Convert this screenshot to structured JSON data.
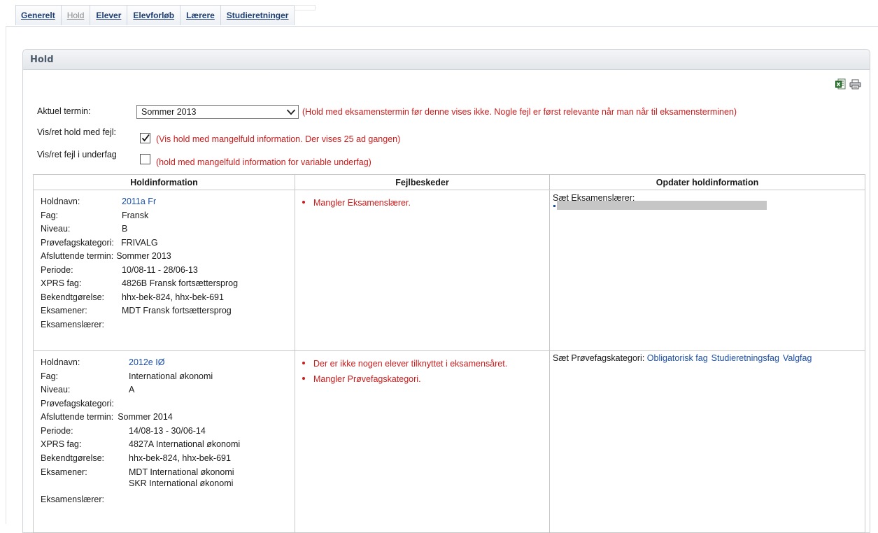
{
  "tabs": [
    {
      "label": "Generelt",
      "disabled": false
    },
    {
      "label": "Hold",
      "disabled": true
    },
    {
      "label": "Elever",
      "disabled": false
    },
    {
      "label": "Elevforløb",
      "disabled": false
    },
    {
      "label": "Lærere",
      "disabled": false
    },
    {
      "label": "Studieretninger",
      "disabled": false
    }
  ],
  "panel": {
    "title": "Hold",
    "icons": [
      "excel-export-icon",
      "print-icon"
    ]
  },
  "filters": {
    "termin_label": "Aktuel termin:",
    "termin_value": "Sommer 2013",
    "termin_hint": "(Hold med eksamenstermin før denne vises ikke. Nogle fejl er først relevante når man når til eksamensterminen)",
    "errors_label": "Vis/ret hold med fejl:",
    "errors_checked": true,
    "errors_hint": "(Vis hold med mangelfuld information. Der vises 25 ad gangen)",
    "sub_label": "Vis/ret fejl i underfag",
    "sub_checked": false,
    "sub_hint": "(hold med mangelfuld information for variable underfag)"
  },
  "table": {
    "headers": [
      "Holdinformation",
      "Fejlbeskeder",
      "Opdater holdinformation"
    ],
    "keys": {
      "holdnavn": "Holdnavn:",
      "fag": "Fag:",
      "niveau": "Niveau:",
      "kategori": "Prøvefagskategori:",
      "termin": "Afsluttende termin:",
      "periode": "Periode:",
      "xprs": "XPRS fag:",
      "bek": "Bekendtgørelse:",
      "eksamener": "Eksamener:",
      "laerer": "Eksamenslærer:"
    },
    "rows": [
      {
        "holdnavn": "2011a Fr",
        "fag": "Fransk",
        "niveau": "B",
        "kategori": "FRIVALG",
        "termin": "Sommer 2013",
        "periode": "10/08-11 - 28/06-13",
        "xprs": "4826B Fransk fortsættersprog",
        "bek": "hhx-bek-824, hhx-bek-691",
        "eksamener": [
          "MDT Fransk fortsættersprog"
        ],
        "laerer": "",
        "errors": [
          "Mangler Eksamenslærer."
        ],
        "update_label": "Sæt Eksamenslærer:",
        "update_links": []
      },
      {
        "holdnavn": "2012e IØ",
        "fag": "International økonomi",
        "niveau": "A",
        "kategori": "",
        "termin": "Sommer 2014",
        "periode": "14/08-13 - 30/06-14",
        "xprs": "4827A International økonomi",
        "bek": "hhx-bek-824, hhx-bek-691",
        "eksamener": [
          "MDT International økonomi",
          "SKR International økonomi"
        ],
        "laerer": "",
        "errors": [
          "Der er ikke nogen elever tilknyttet i eksamensåret.",
          "Mangler Prøvefagskategori."
        ],
        "update_label": "Sæt Prøvefagskategori:",
        "update_links": [
          "Obligatorisk fag",
          "Studieretningsfag",
          "Valgfag"
        ]
      }
    ]
  },
  "colors": {
    "link": "#1b4fa8",
    "error": "#cc1b1b",
    "tab_text": "#1f3f73"
  }
}
